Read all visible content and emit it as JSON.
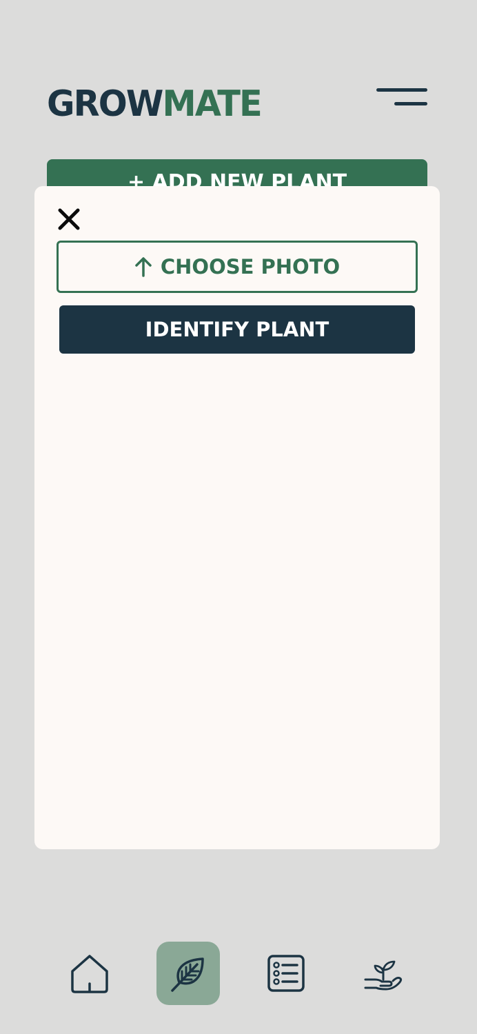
{
  "header": {
    "logo_part1": "GROW",
    "logo_part2": "MATE",
    "menu_icon": "hamburger-menu-icon"
  },
  "background": {
    "add_plant_label": "+ ADD NEW PLANT"
  },
  "modal": {
    "close_icon": "close-icon",
    "choose_photo_icon": "arrow-up-icon",
    "choose_photo_label": "CHOOSE PHOTO",
    "identify_label": "IDENTIFY PLANT"
  },
  "bottom_nav": {
    "items": [
      {
        "icon": "home-icon",
        "active": false
      },
      {
        "icon": "leaf-icon",
        "active": true
      },
      {
        "icon": "list-icon",
        "active": false
      },
      {
        "icon": "plant-in-hand-icon",
        "active": false
      }
    ]
  },
  "colors": {
    "dark_navy": "#1c3443",
    "brand_green": "#347153",
    "active_nav_bg": "#8aa896",
    "modal_bg": "#fdf9f6",
    "page_bg": "#dcdcdb"
  }
}
